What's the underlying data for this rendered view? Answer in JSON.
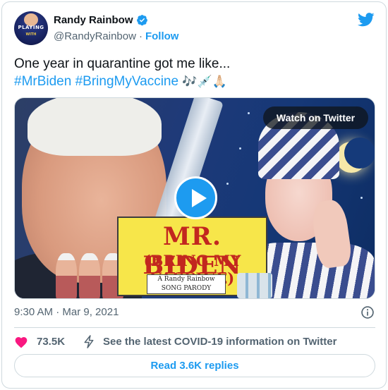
{
  "author": {
    "display_name": "Randy Rainbow",
    "handle": "@RandyRainbow",
    "separator": "·",
    "follow_label": "Follow",
    "avatar_text": "PLAYING",
    "avatar_subtext": "WITH"
  },
  "tweet": {
    "line1": "One year in quarantine got me like...",
    "hashtag1": "#MrBiden",
    "hashtag2": "#BringMyVaccine",
    "emojis": "🎶💉🙏🏻"
  },
  "media": {
    "watch_label": "Watch on Twitter",
    "title_line1": "MR. BIDEN",
    "title_line2": "(BRING MY VACCINE)",
    "subtitle_line1": "A Randy Rainbow",
    "subtitle_line2": "SONG PARODY"
  },
  "meta": {
    "timestamp": "9:30 AM · Mar 9, 2021"
  },
  "actions": {
    "like_count": "73.5K",
    "covid_info": "See the latest COVID-19 information on Twitter",
    "replies_label": "Read 3.6K replies"
  },
  "colors": {
    "accent": "#1d9bf0",
    "heart": "#f91880",
    "secondary_text": "#536471"
  },
  "icons": {
    "verified": "verified-badge-icon",
    "brand": "twitter-bird-icon",
    "play": "play-icon",
    "info": "info-icon",
    "like": "heart-icon",
    "covid": "lightning-icon"
  }
}
